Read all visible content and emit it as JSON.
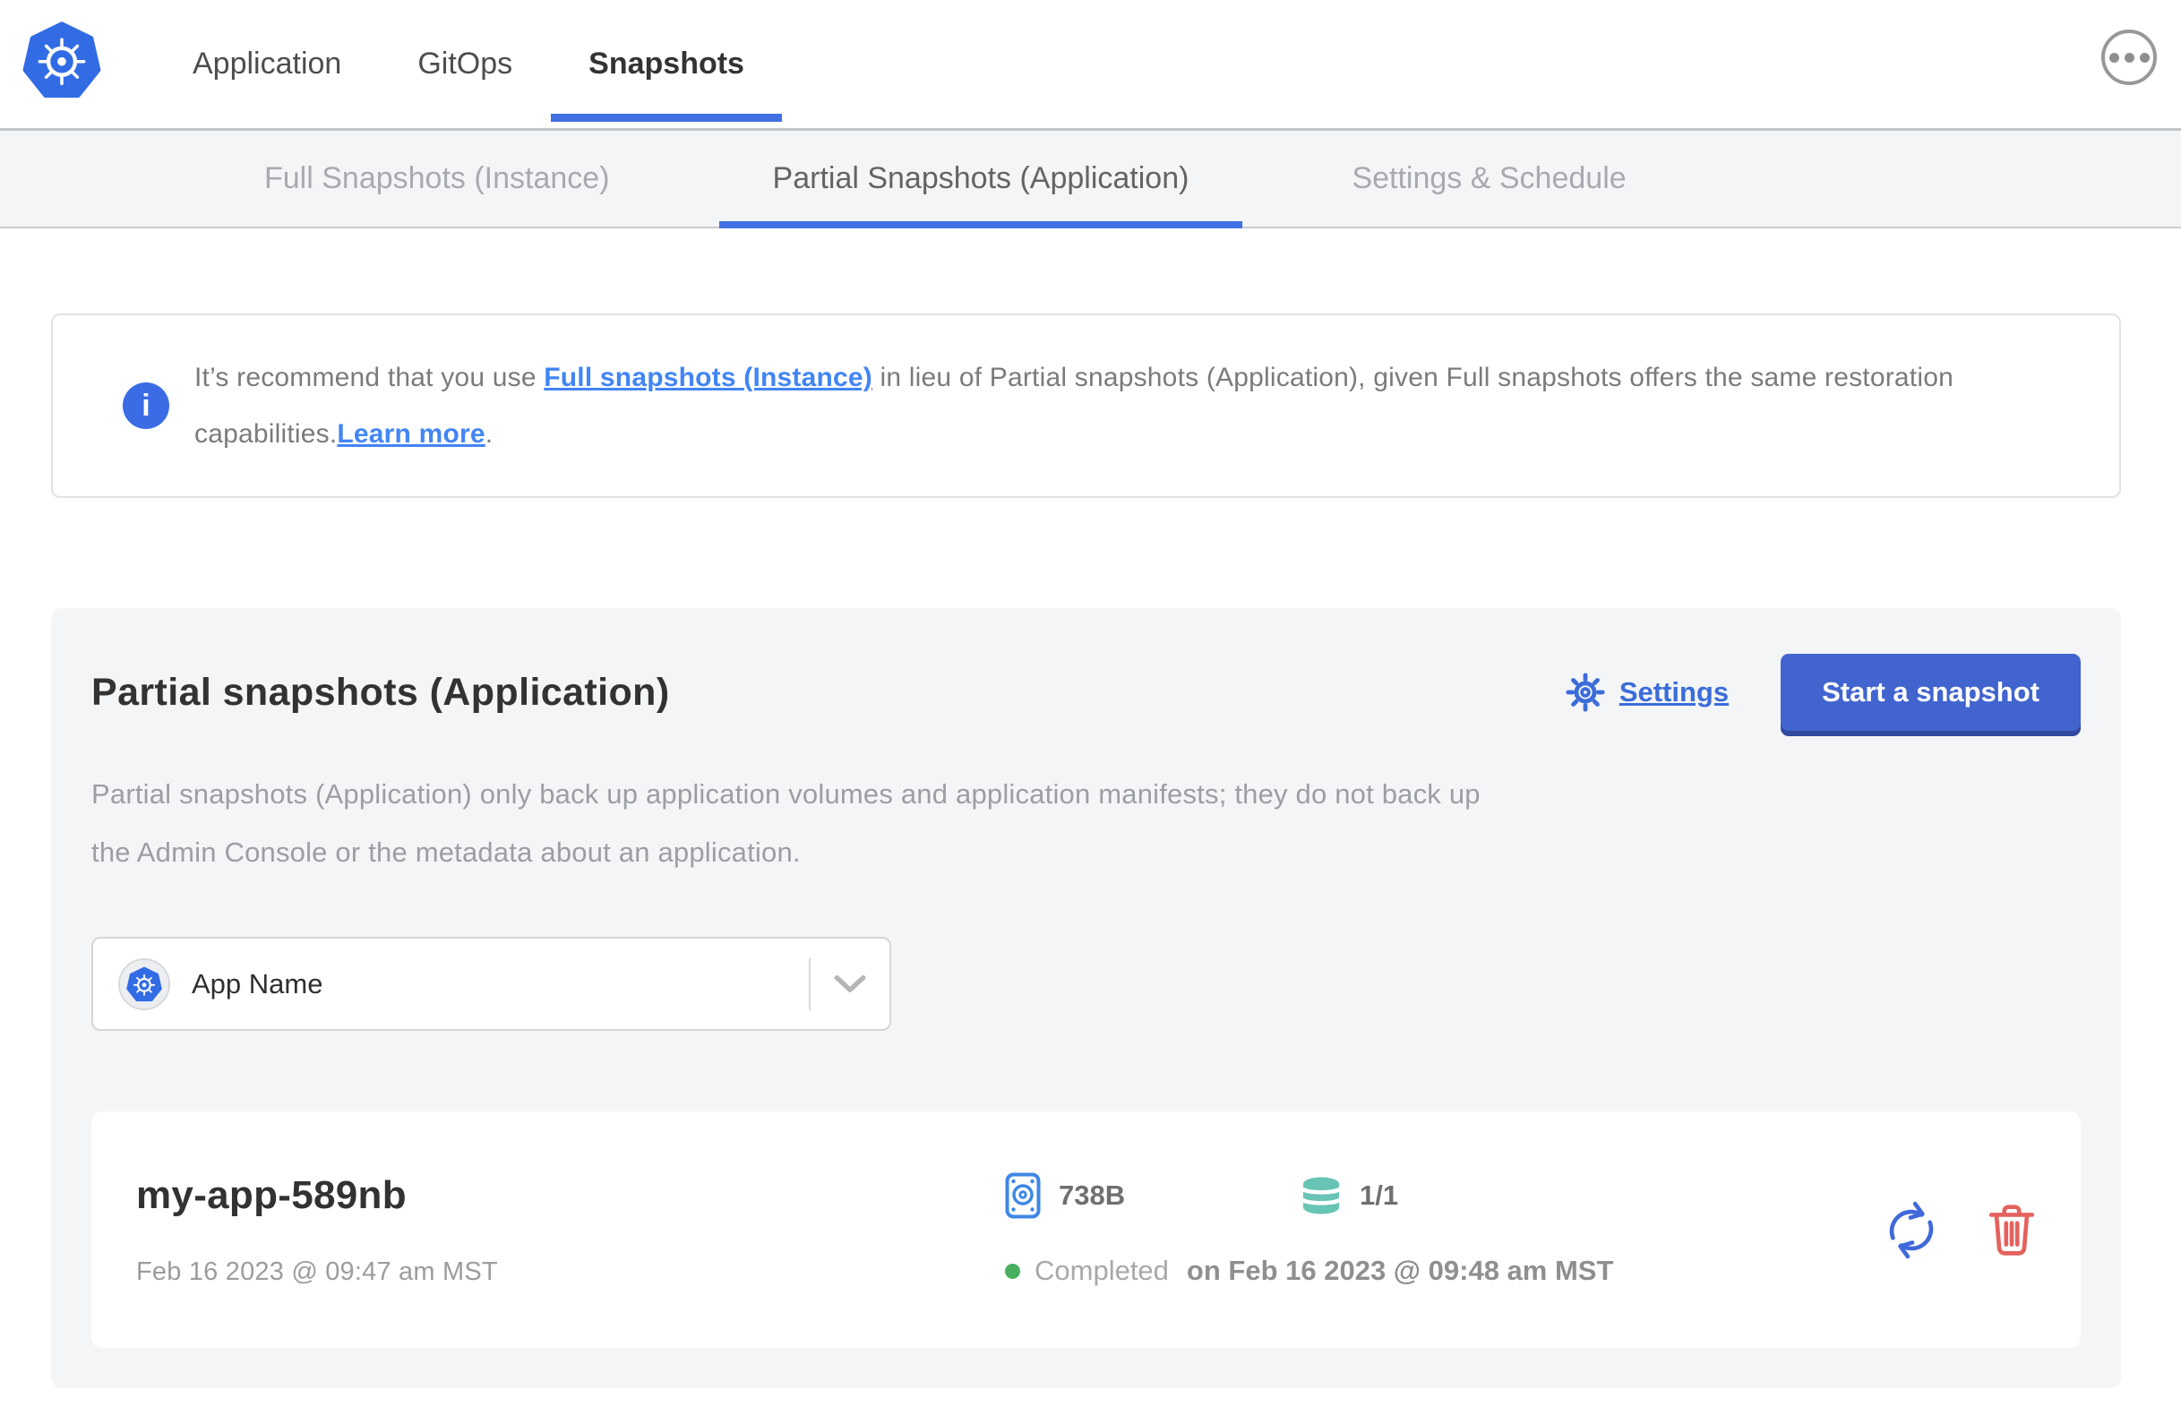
{
  "header": {
    "tabs": [
      "Application",
      "GitOps",
      "Snapshots"
    ],
    "active_tab": "Snapshots"
  },
  "subnav": {
    "tabs": [
      "Full Snapshots (Instance)",
      "Partial Snapshots (Application)",
      "Settings & Schedule"
    ],
    "active_tab": "Partial Snapshots (Application)"
  },
  "banner": {
    "icon_glyph": "i",
    "text_before_link1": "It’s recommend that you use ",
    "link1": "Full snapshots (Instance)",
    "text_between": " in lieu of Partial snapshots (Application), given Full snapshots offers the same restoration capabilities.",
    "link2": "Learn more",
    "text_after": "."
  },
  "panel": {
    "title": "Partial snapshots (Application)",
    "settings_label": "Settings",
    "start_snapshot_label": "Start a snapshot",
    "description_line1": "Partial snapshots (Application) only back up application volumes and application manifests; they do not back up",
    "description_line2": "the Admin Console or the metadata about an application.",
    "app_selector_value": "App Name"
  },
  "snapshot": {
    "name": "my-app-589nb",
    "created_at": "Feb 16 2023 @ 09:47 am MST",
    "size": "738B",
    "volumes": "1/1",
    "status": "Completed",
    "status_timestamp": "on Feb 16 2023 @ 09:48 am MST"
  },
  "icons": {
    "logo": "kubernetes-logo",
    "overflow_menu": "ellipsis-icon",
    "banner": "info-icon",
    "settings": "gear-icon",
    "app_selector": "kubernetes-app-icon",
    "app_selector_caret": "chevron-down-icon",
    "size": "disk-icon",
    "volumes": "database-icon",
    "status": "status-dot",
    "restore": "restore-icon",
    "delete": "trash-icon"
  },
  "colors": {
    "nav_underline_blue": "#4170e2",
    "link_blue": "#4285f4",
    "settings_blue": "#3b6cda",
    "button_blue": "#4164cf",
    "kubernetes_blue": "#326ce5",
    "disk_icon_blue": "#3d87e4",
    "database_teal": "#68c4b4",
    "trash_red": "#e4625e",
    "status_green": "#48b05e",
    "panel_gray": "#f4f5f7"
  }
}
